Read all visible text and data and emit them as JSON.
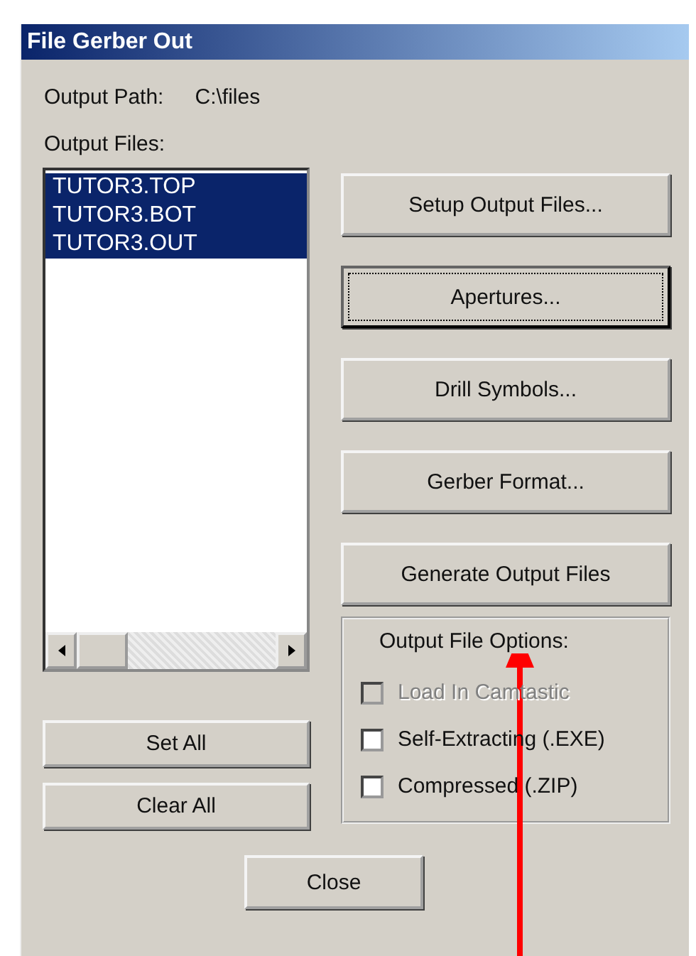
{
  "window": {
    "title": "File Gerber Out"
  },
  "output_path": {
    "label": "Output Path:",
    "value": "C:\\files"
  },
  "output_files": {
    "label": "Output Files:",
    "items": [
      {
        "name": "TUTOR3.TOP",
        "selected": true
      },
      {
        "name": "TUTOR3.BOT",
        "selected": true
      },
      {
        "name": "TUTOR3.OUT",
        "selected": true
      }
    ]
  },
  "left_buttons": [
    {
      "label": "Set All"
    },
    {
      "label": "Clear All"
    }
  ],
  "right_buttons": [
    {
      "label": "Setup Output Files...",
      "focused": false
    },
    {
      "label": "Apertures...",
      "focused": true
    },
    {
      "label": "Drill Symbols...",
      "focused": false
    },
    {
      "label": "Gerber Format...",
      "focused": false
    },
    {
      "label": "Generate Output Files",
      "focused": false
    }
  ],
  "options": {
    "title": "Output File Options:",
    "items": [
      {
        "label": "Load In Camtastic",
        "checked": false,
        "disabled": true
      },
      {
        "label": "Self-Extracting (.EXE)",
        "checked": false,
        "disabled": false
      },
      {
        "label": "Compressed (.ZIP)",
        "checked": false,
        "disabled": false
      }
    ]
  },
  "close_button": {
    "label": "Close"
  }
}
